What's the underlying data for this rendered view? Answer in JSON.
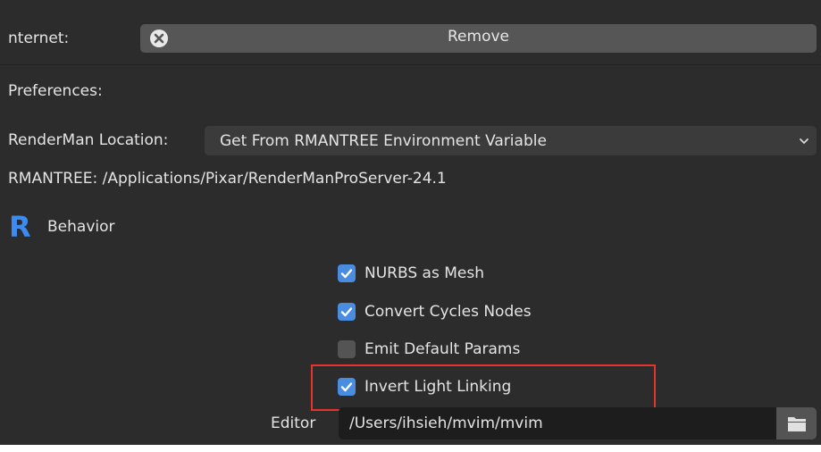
{
  "internet": {
    "label": "nternet:",
    "remove_button": "Remove"
  },
  "preferences": {
    "heading": "Preferences:"
  },
  "location": {
    "label": "RenderMan Location:",
    "value": "Get From RMANTREE Environment Variable"
  },
  "rmantree": {
    "text": "RMANTREE: /Applications/Pixar/RenderManProServer-24.1"
  },
  "behavior": {
    "heading": "Behavior",
    "logo_letter": "R",
    "options": [
      {
        "label": "NURBS as Mesh",
        "checked": true
      },
      {
        "label": "Convert Cycles Nodes",
        "checked": true
      },
      {
        "label": "Emit Default Params",
        "checked": false
      },
      {
        "label": "Invert Light Linking",
        "checked": true
      }
    ]
  },
  "editor": {
    "label": "Editor",
    "value": "/Users/ihsieh/mvim/mvim"
  },
  "colors": {
    "panel_bg": "#2c2c2c",
    "button_bg": "#565656",
    "checkbox_on": "#4a8de0",
    "highlight_border": "#e5342e",
    "logo_blue": "#3b8bf0"
  },
  "icons": [
    "close-circle-icon",
    "chevron-down-icon",
    "renderman-logo-icon",
    "checkmark-icon",
    "folder-icon"
  ]
}
